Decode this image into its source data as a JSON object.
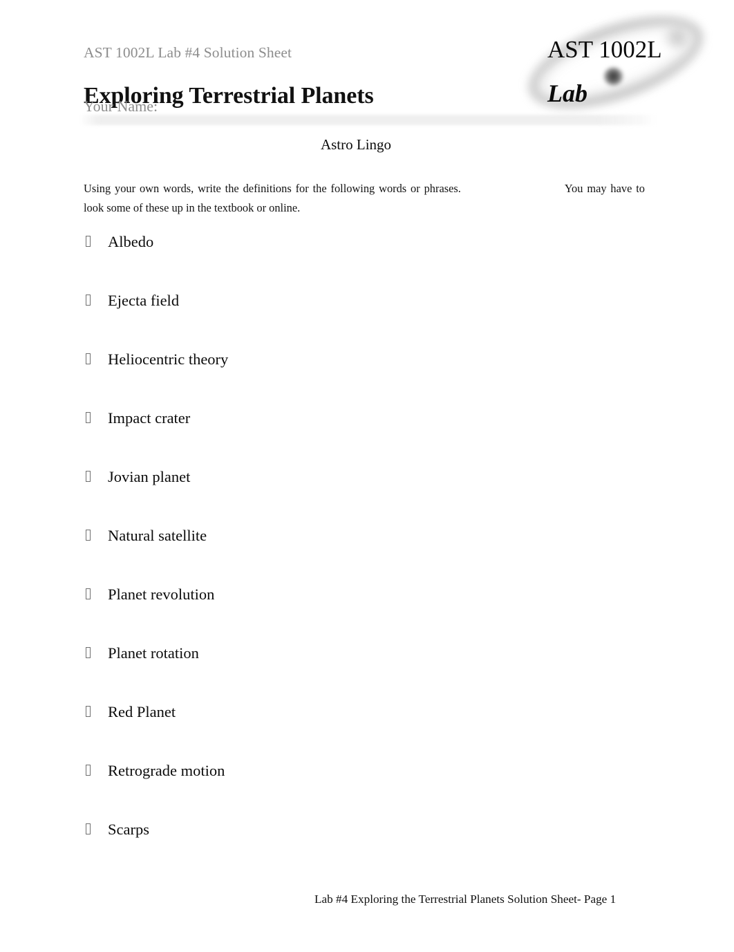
{
  "document": {
    "subtitle": "AST 1002L Lab #4 Solution Sheet",
    "title": "Exploring Terrestrial Planets",
    "name_field_label": "Your Name:"
  },
  "logo": {
    "line1": "AST 1002L",
    "line2": "Lab"
  },
  "section": {
    "heading": "Astro Lingo",
    "instructions_part1": "Using your own words, write the definitions for the following words or phrases.",
    "instructions_part2": "You may have to look some of these up in the textbook or online."
  },
  "terms": [
    {
      "label": "Albedo"
    },
    {
      "label": "Ejecta field"
    },
    {
      "label": "Heliocentric theory"
    },
    {
      "label": "Impact crater"
    },
    {
      "label": "Jovian planet"
    },
    {
      "label": "Natural satellite"
    },
    {
      "label": "Planet revolution"
    },
    {
      "label": "Planet rotation"
    },
    {
      "label": "Red Planet"
    },
    {
      "label": "Retrograde motion"
    },
    {
      "label": "Scarps"
    }
  ],
  "footer": {
    "text": "Lab #4 Exploring the Terrestrial Planets Solution Sheet- Page 1"
  },
  "colors": {
    "page_background": "#ffffff",
    "body_text": "#0b0b0b",
    "muted_text": "#8d8d8d",
    "band": "#eeeeee"
  }
}
